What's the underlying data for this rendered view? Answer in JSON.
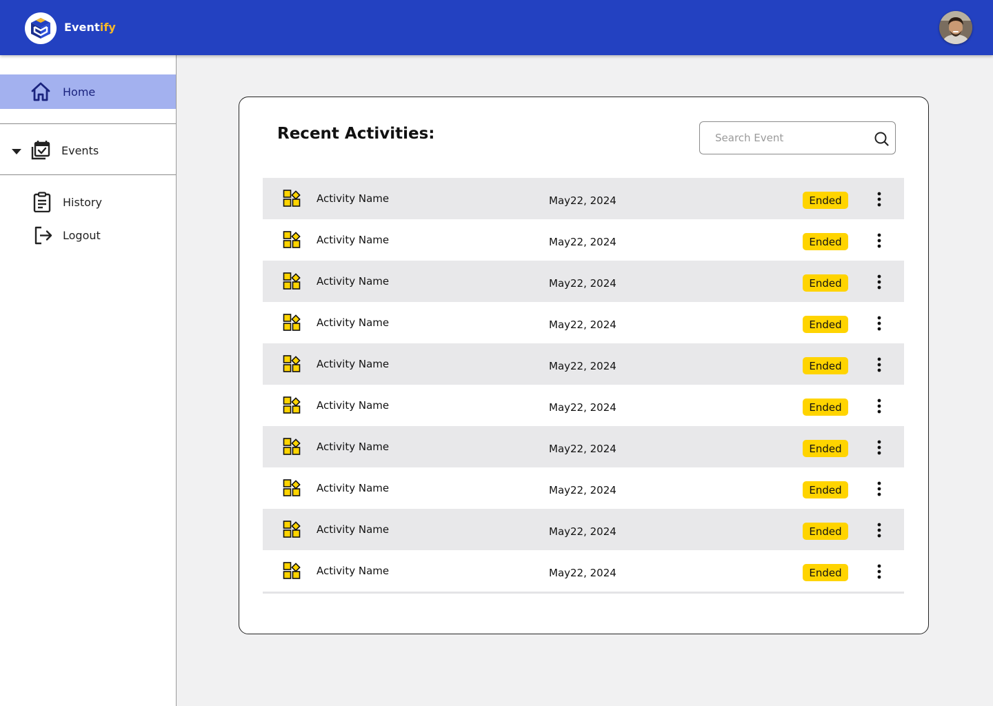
{
  "app": {
    "brand_main": "Event",
    "brand_accent": "ify",
    "brand_color": "#2341c1",
    "accent_color": "#f5b82a"
  },
  "sidebar": {
    "home": {
      "label": "Home",
      "icon": "home-icon"
    },
    "events": {
      "label": "Events",
      "icon": "calendar-check-icon"
    },
    "history": {
      "label": "History",
      "icon": "clipboard-list-icon"
    },
    "logout": {
      "label": "Logout",
      "icon": "logout-icon"
    }
  },
  "main": {
    "title": "Recent Activities:",
    "search": {
      "placeholder": "Search Event",
      "value": ""
    },
    "status_color": "#ffd400",
    "rows": [
      {
        "name": "Activity Name",
        "date": "May22, 2024",
        "status": "Ended"
      },
      {
        "name": "Activity Name",
        "date": "May22, 2024",
        "status": "Ended"
      },
      {
        "name": "Activity Name",
        "date": "May22, 2024",
        "status": "Ended"
      },
      {
        "name": "Activity Name",
        "date": "May22, 2024",
        "status": "Ended"
      },
      {
        "name": "Activity Name",
        "date": "May22, 2024",
        "status": "Ended"
      },
      {
        "name": "Activity Name",
        "date": "May22, 2024",
        "status": "Ended"
      },
      {
        "name": "Activity Name",
        "date": "May22, 2024",
        "status": "Ended"
      },
      {
        "name": "Activity Name",
        "date": "May22, 2024",
        "status": "Ended"
      },
      {
        "name": "Activity Name",
        "date": "May22, 2024",
        "status": "Ended"
      },
      {
        "name": "Activity Name",
        "date": "May22, 2024",
        "status": "Ended"
      }
    ]
  }
}
